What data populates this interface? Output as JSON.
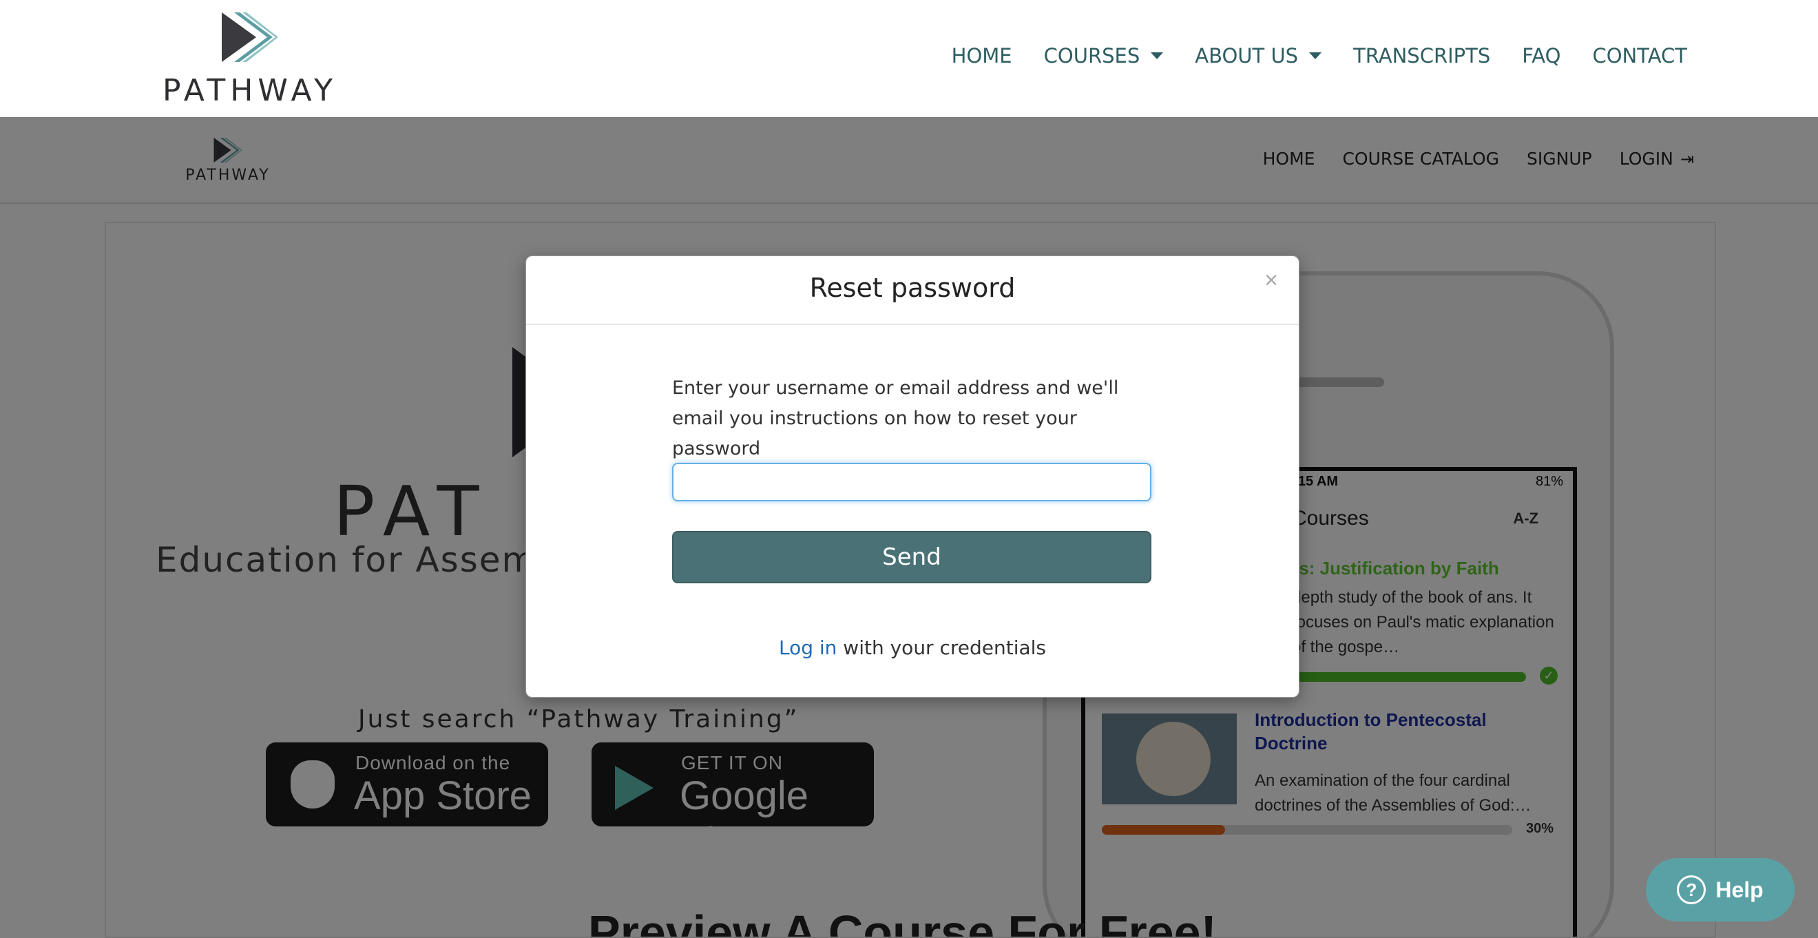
{
  "site": {
    "logo_text": "PATHWAY",
    "nav": {
      "home": "HOME",
      "courses": "COURSES",
      "about": "ABOUT US",
      "transcripts": "TRANSCRIPTS",
      "faq": "FAQ",
      "contact": "CONTACT"
    }
  },
  "portal": {
    "logo_text": "PATHWAY",
    "nav": {
      "home": "HOME",
      "catalog": "COURSE CATALOG",
      "signup": "SIGNUP",
      "login": "LOGIN"
    },
    "hero": {
      "word": "PAT",
      "tagline": "Education for Assemb",
      "search_text": "Just search “Pathway Training”",
      "appstore_small": "Download on the",
      "appstore_big": "App Store",
      "google_small": "GET IT ON",
      "google_big": "Google Play"
    },
    "phone": {
      "time": "10:15 AM",
      "battery": "81%",
      "title": "Courses",
      "sort": "A-Z",
      "course1_title": "ans: Justification by Faith",
      "course1_desc": "depth study of the book of ans. It focuses on Paul's matic explanation of the gospe…",
      "course2_title": "Introduction to Pentecostal Doctrine",
      "course2_desc": "An examination of the four cardinal doctrines of the Assemblies of God:…",
      "course2_progress": "30%"
    },
    "preview_heading": "Preview A Course For Free!"
  },
  "modal": {
    "title": "Reset password",
    "close": "×",
    "description": "Enter your username or email address and we'll email you instructions on how to reset your password",
    "input_value": "",
    "send_label": "Send",
    "login_link": "Log in",
    "login_suffix": " with your credentials"
  },
  "help": {
    "label": "Help",
    "icon": "?"
  },
  "colors": {
    "brand_teal": "#2e5d61",
    "send_button": "#4a7175",
    "link_blue": "#1f6bb5",
    "help_button": "#5aa1a6"
  }
}
